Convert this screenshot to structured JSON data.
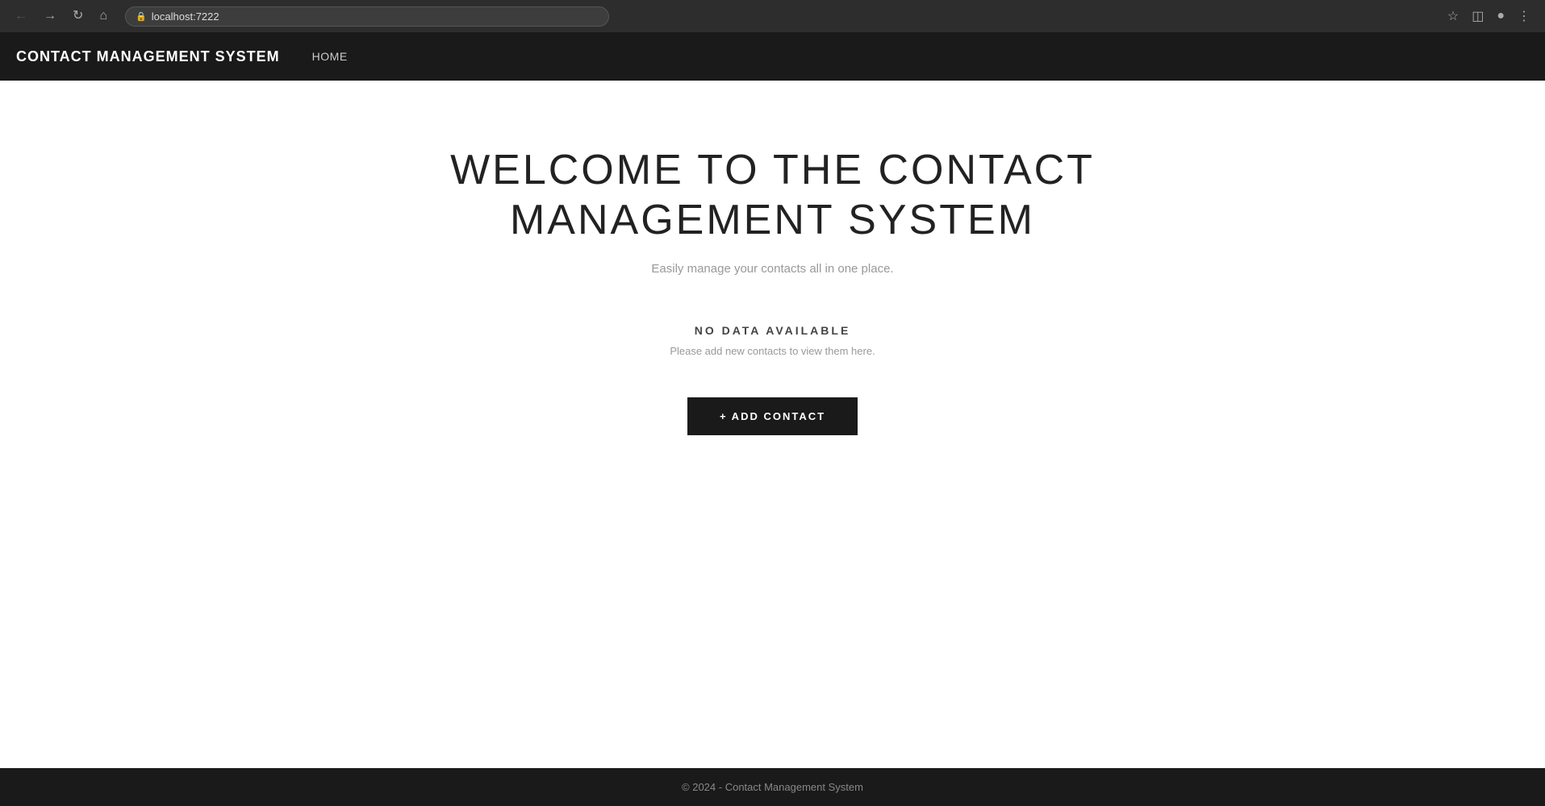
{
  "browser": {
    "url": "localhost:7222",
    "back_btn": "←",
    "forward_btn": "→",
    "reload_btn": "↻",
    "home_btn": "⌂"
  },
  "navbar": {
    "brand": "CONTACT MANAGEMENT SYSTEM",
    "nav_items": [
      {
        "label": "HOME",
        "href": "#"
      }
    ]
  },
  "main": {
    "title": "WELCOME TO THE CONTACT MANAGEMENT SYSTEM",
    "subtitle": "Easily manage your contacts all in one place.",
    "empty_state": {
      "title": "NO DATA AVAILABLE",
      "subtitle": "Please add new contacts to view them here."
    },
    "add_contact_btn": "+ ADD CONTACT"
  },
  "footer": {
    "text": "© 2024 - Contact Management System"
  }
}
